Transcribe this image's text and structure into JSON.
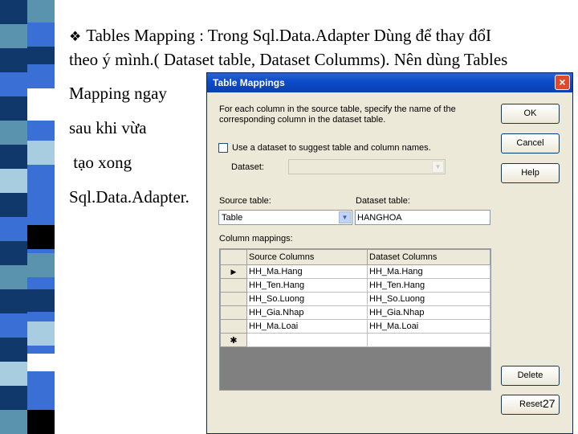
{
  "slide": {
    "lines": [
      "Tables Mapping : Trong Sql.Data.Adapter  Dùng để thay đổI",
      "theo ý mình.( Dataset table, Dataset Columms). Nên dùng Tables",
      "Mapping ngay",
      "sau khi vừa",
      " tạo xong",
      "Sql.Data.Adapter."
    ],
    "bullet_icon": "diamond-bullet-icon",
    "page_number": "27"
  },
  "dialog": {
    "title": "Table Mappings",
    "close_label": "×",
    "instructions_line1": "For each column in the source table, specify the name of the",
    "instructions_line2": "corresponding column in the dataset table.",
    "use_dataset_label": "Use a dataset to suggest table and column names.",
    "use_dataset_checked": false,
    "dataset_label": "Dataset:",
    "dataset_value": "",
    "source_table_label": "Source table:",
    "source_table_value": "Table",
    "dataset_table_label": "Dataset table:",
    "dataset_table_value": "HANGHOA",
    "column_mappings_label": "Column mappings:",
    "buttons": {
      "ok": "OK",
      "cancel": "Cancel",
      "help": "Help",
      "delete": "Delete",
      "reset": "Reset"
    },
    "grid": {
      "headers": [
        "Source Columns",
        "Dataset Columns"
      ],
      "rows": [
        [
          "HH_Ma.Hang",
          "HH_Ma.Hang"
        ],
        [
          "HH_Ten.Hang",
          "HH_Ten.Hang"
        ],
        [
          "HH_So.Luong",
          "HH_So.Luong"
        ],
        [
          "HH_Gia.Nhap",
          "HH_Gia.Nhap"
        ],
        [
          "HH_Ma.Loai",
          "HH_Ma.Loai"
        ]
      ],
      "current_row_marker": "▶",
      "new_row_marker": "✱"
    }
  },
  "colors": {
    "stripe_dark": "#10386b",
    "stripe_blue": "#3a6fd6",
    "stripe_teal": "#5a93ad",
    "stripe_light": "#a8cde0",
    "stripe_black": "#000000",
    "stripe_white": "#ffffff"
  }
}
